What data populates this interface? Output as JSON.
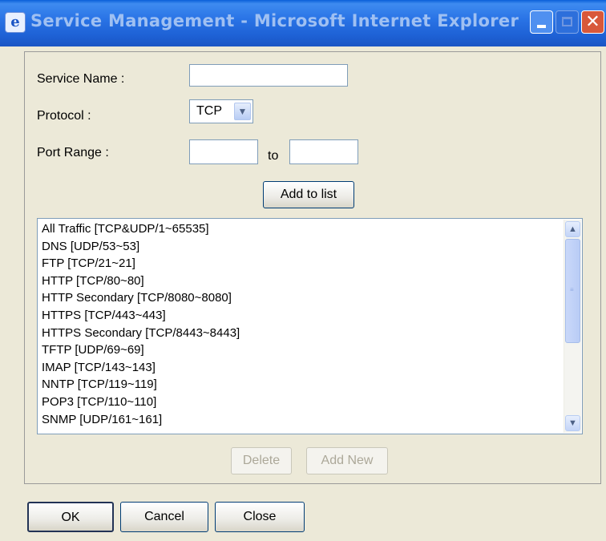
{
  "window": {
    "title": "Service Management - Microsoft Internet Explorer",
    "icon": "ie-icon",
    "controls": [
      "minimize-icon",
      "maximize-icon",
      "close-icon"
    ]
  },
  "form": {
    "service_name_label": "Service Name :",
    "service_name_value": "",
    "protocol_label": "Protocol :",
    "protocol_value": "TCP",
    "port_range_label": "Port Range :",
    "port_from_value": "",
    "port_to_label": "to",
    "port_to_value": "",
    "add_to_list_label": "Add to list"
  },
  "services": [
    "All Traffic [TCP&UDP/1~65535]",
    "DNS [UDP/53~53]",
    "FTP [TCP/21~21]",
    "HTTP [TCP/80~80]",
    "HTTP Secondary [TCP/8080~8080]",
    "HTTPS [TCP/443~443]",
    "HTTPS Secondary [TCP/8443~8443]",
    "TFTP [UDP/69~69]",
    "IMAP [TCP/143~143]",
    "NNTP [TCP/119~119]",
    "POP3 [TCP/110~110]",
    "SNMP [UDP/161~161]"
  ],
  "list_actions": {
    "delete_label": "Delete",
    "add_new_label": "Add New"
  },
  "footer": {
    "ok_label": "OK",
    "cancel_label": "Cancel",
    "close_label": "Close"
  }
}
